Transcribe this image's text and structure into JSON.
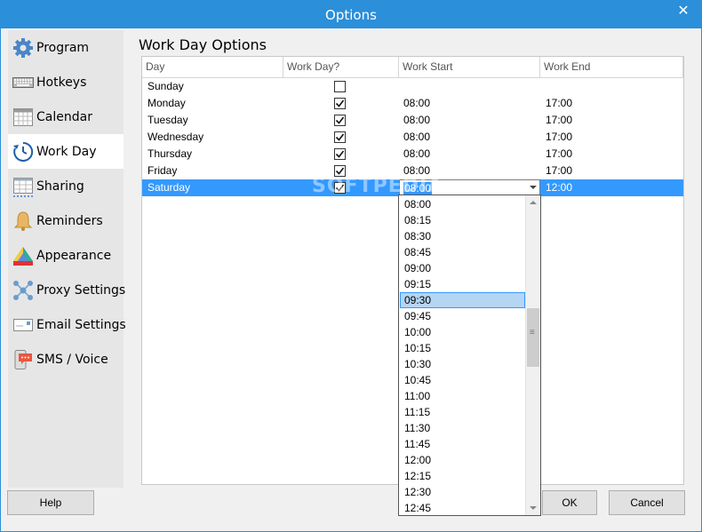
{
  "window": {
    "title": "Options",
    "close_glyph": "✕"
  },
  "sidebar": {
    "items": [
      {
        "label": "Program",
        "icon": "gear-icon",
        "active": false
      },
      {
        "label": "Hotkeys",
        "icon": "keyboard-icon",
        "active": false
      },
      {
        "label": "Calendar",
        "icon": "calendar-icon",
        "active": false
      },
      {
        "label": "Work Day",
        "icon": "clock-icon",
        "active": true
      },
      {
        "label": "Sharing",
        "icon": "sharing-grid-icon",
        "active": false
      },
      {
        "label": "Reminders",
        "icon": "bell-icon",
        "active": false
      },
      {
        "label": "Appearance",
        "icon": "palette-icon",
        "active": false
      },
      {
        "label": "Proxy Settings",
        "icon": "network-icon",
        "active": false
      },
      {
        "label": "Email Settings",
        "icon": "envelope-icon",
        "active": false
      },
      {
        "label": "SMS / Voice",
        "icon": "sms-bubble-icon",
        "active": false
      }
    ]
  },
  "main": {
    "title": "Work Day Options",
    "columns": [
      "Day",
      "Work Day?",
      "Work Start",
      "Work End"
    ],
    "rows": [
      {
        "day": "Sunday",
        "work_day": false,
        "start": "",
        "end": ""
      },
      {
        "day": "Monday",
        "work_day": true,
        "start": "08:00",
        "end": "17:00"
      },
      {
        "day": "Tuesday",
        "work_day": true,
        "start": "08:00",
        "end": "17:00"
      },
      {
        "day": "Wednesday",
        "work_day": true,
        "start": "08:00",
        "end": "17:00"
      },
      {
        "day": "Thursday",
        "work_day": true,
        "start": "08:00",
        "end": "17:00"
      },
      {
        "day": "Friday",
        "work_day": true,
        "start": "08:00",
        "end": "17:00"
      },
      {
        "day": "Saturday",
        "work_day": true,
        "start": "08:00",
        "end": "12:00",
        "selected": true
      }
    ],
    "editor": {
      "value": "08:00"
    },
    "dropdown": {
      "options": [
        "08:00",
        "08:15",
        "08:30",
        "08:45",
        "09:00",
        "09:15",
        "09:30",
        "09:45",
        "10:00",
        "10:15",
        "10:30",
        "10:45",
        "11:00",
        "11:15",
        "11:30",
        "11:45",
        "12:00",
        "12:15",
        "12:30",
        "12:45"
      ],
      "highlighted": "09:30"
    }
  },
  "watermark": "SOFTPEDIA",
  "footer": {
    "help_label": "Help",
    "ok_label": "OK",
    "cancel_label": "Cancel"
  },
  "colors": {
    "titlebar": "#2b8fd9",
    "selection": "#3399ff",
    "highlight": "#b5d5f4"
  }
}
